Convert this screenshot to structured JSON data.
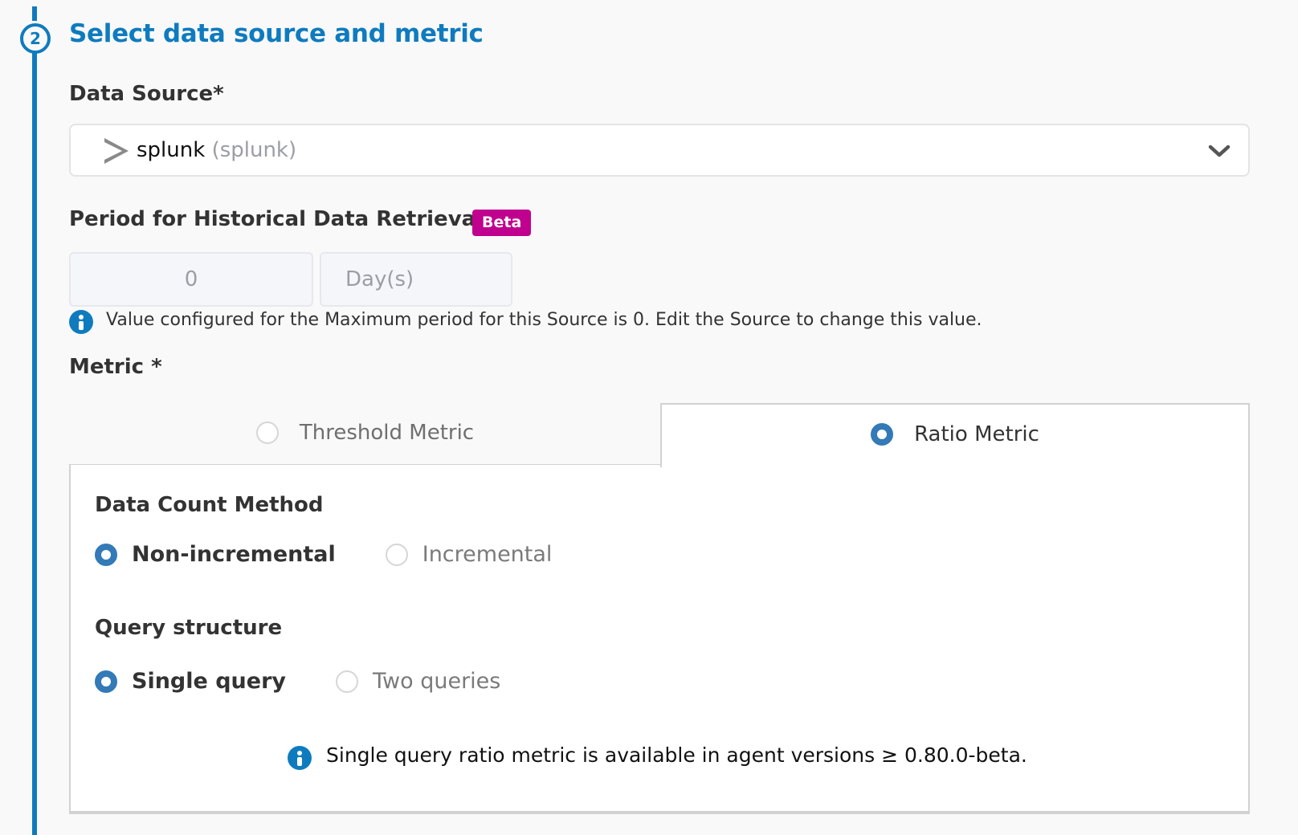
{
  "step": {
    "number": "2",
    "title": "Select data source and metric",
    "accent_color": "#0f7bbf"
  },
  "data_source": {
    "label": "Data Source*",
    "selected_name": "splunk",
    "selected_type": "(splunk)",
    "icon": "splunk-chevron-icon",
    "dropdown_icon": "chevron-down-icon"
  },
  "period": {
    "label": "Period for Historical Data Retrieval *",
    "badge": "Beta",
    "badge_color": "#c0008e",
    "value": "0",
    "unit": "Day(s)",
    "info_icon": "info-icon",
    "info_text": "Value configured for the Maximum period for this Source is 0. Edit the Source to change this value."
  },
  "metric": {
    "label": "Metric *",
    "tabs": [
      {
        "label": "Threshold Metric",
        "selected": false
      },
      {
        "label": "Ratio Metric",
        "selected": true
      }
    ],
    "data_count_method": {
      "heading": "Data Count Method",
      "options": [
        {
          "label": "Non-incremental",
          "selected": true
        },
        {
          "label": "Incremental",
          "selected": false
        }
      ]
    },
    "query_structure": {
      "heading": "Query structure",
      "options": [
        {
          "label": "Single query",
          "selected": true
        },
        {
          "label": "Two queries",
          "selected": false
        }
      ]
    },
    "info_text": "Single query ratio metric is available in agent versions ≥ 0.80.0-beta.",
    "radio_color": "#337ab7"
  }
}
